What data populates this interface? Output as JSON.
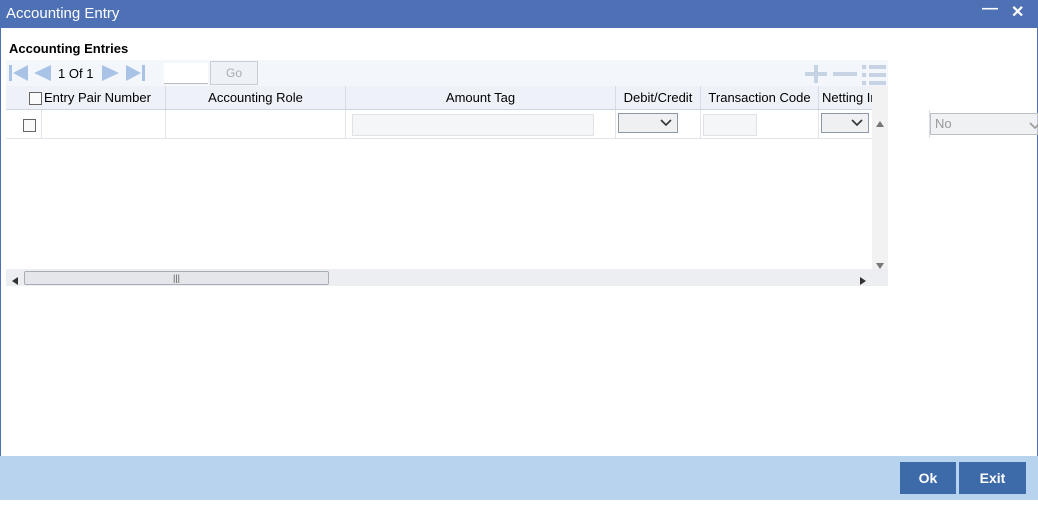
{
  "window": {
    "title": "Accounting Entry",
    "minimize_glyph": "—",
    "close_glyph": "✕"
  },
  "section": {
    "title": "Accounting Entries"
  },
  "pagination": {
    "current": "1",
    "of_label": "Of",
    "total": "1",
    "go_label": "Go",
    "page_input_value": ""
  },
  "table": {
    "columns": [
      "Entry Pair Number",
      "Accounting Role",
      "Amount Tag",
      "Debit/Credit",
      "Transaction Code",
      "Netting Ind"
    ],
    "rows": [
      {
        "entry_pair_number": "",
        "accounting_role": "",
        "amount_tag": "",
        "debit_credit": "",
        "transaction_code": "",
        "netting_ind": "",
        "extra_select": "No"
      }
    ]
  },
  "footer": {
    "ok_label": "Ok",
    "exit_label": "Exit"
  },
  "icons": {
    "first": "first-page-icon",
    "prev": "previous-page-icon",
    "next": "next-page-icon",
    "last": "last-page-icon",
    "add": "add-row-icon",
    "delete": "delete-row-icon",
    "view": "single-view-icon"
  },
  "colors": {
    "title_bar": "#4d71b4",
    "footer": "#b8d3ed",
    "button": "#3d6aa8"
  }
}
